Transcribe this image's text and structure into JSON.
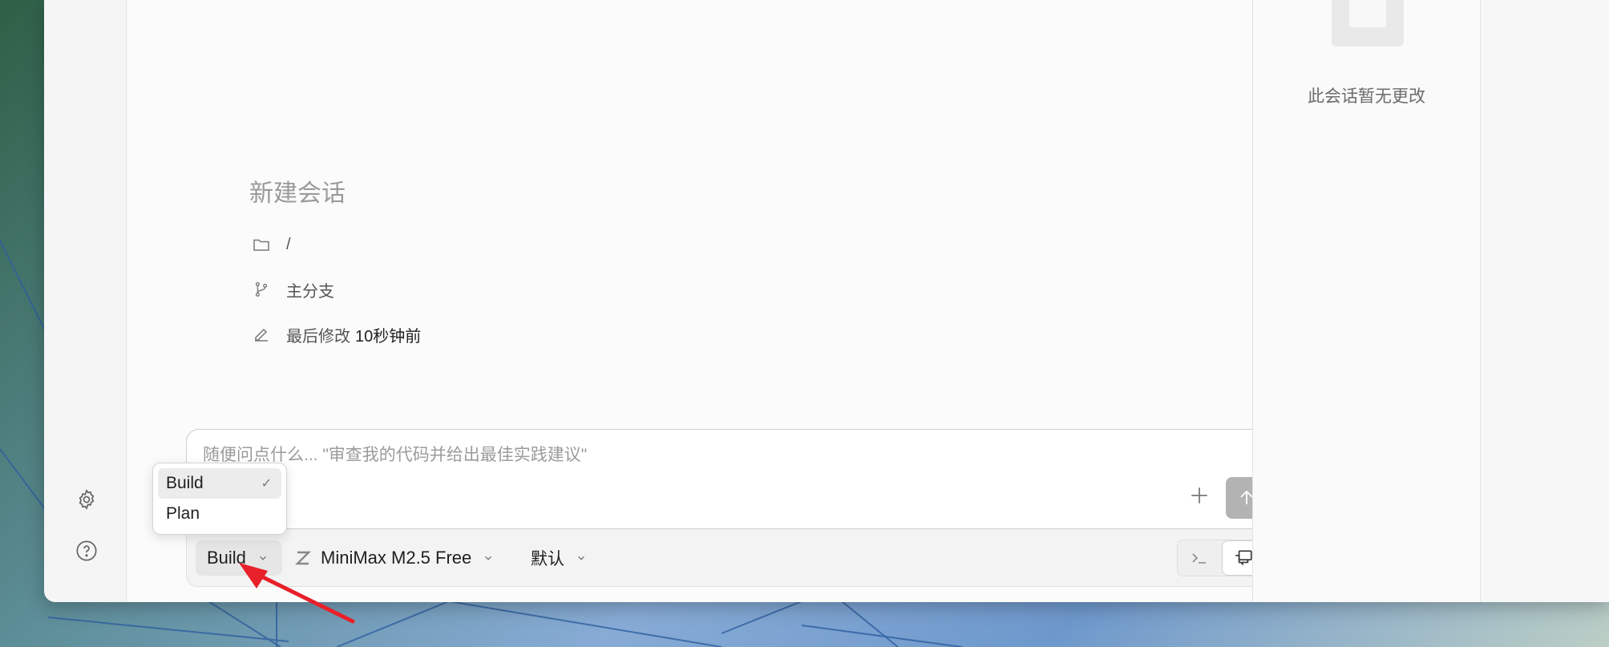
{
  "session": {
    "title": "新建会话",
    "directory": "/",
    "branch": "主分支",
    "modified_label": "最后修改",
    "modified_value": "10秒钟前"
  },
  "side_panel": {
    "empty_text": "此会话暂无更改"
  },
  "composer": {
    "placeholder": "随便问点什么... \"审查我的代码并给出最佳实践建议\""
  },
  "toolbar": {
    "agent_label": "Build",
    "model_label": "MiniMax M2.5 Free",
    "variant_label": "默认"
  },
  "agent_menu": {
    "items": [
      {
        "label": "Build",
        "selected": true,
        "check": "✓"
      },
      {
        "label": "Plan",
        "selected": false
      }
    ]
  },
  "colors": {
    "annotation_arrow": "#e8202a",
    "send_button": "#b3b3b3"
  }
}
